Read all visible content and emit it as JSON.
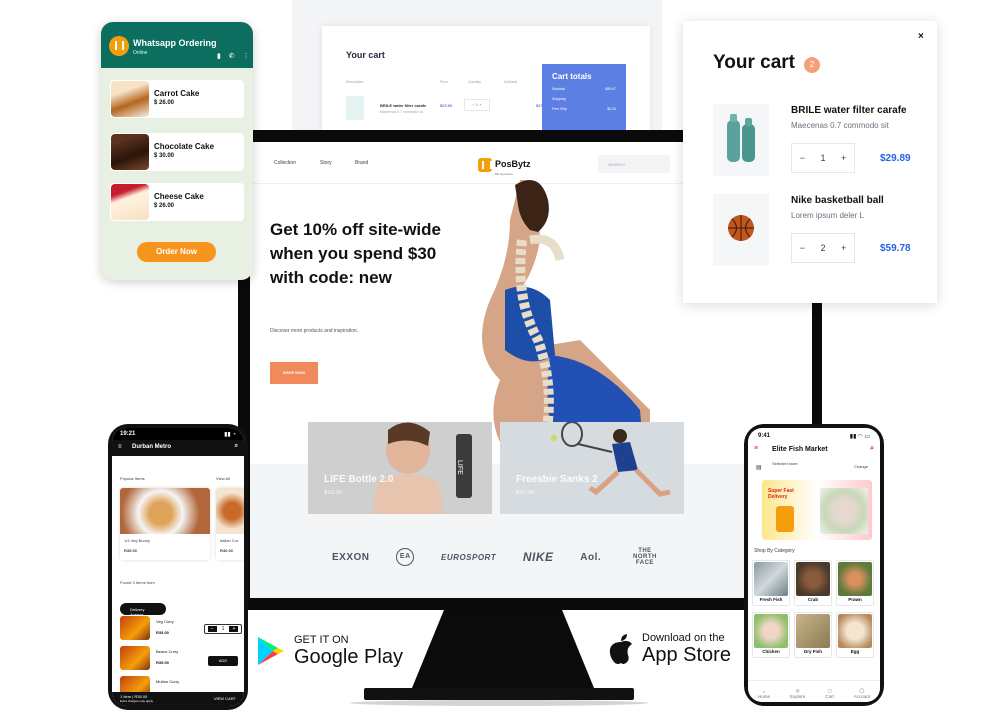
{
  "bg_cart": {
    "title": "Your cart",
    "headers": [
      "Description",
      "Price",
      "Quantity",
      "Subtotal"
    ],
    "item_name": "BRILE water filter carafe",
    "item_sub": "Maecenas 0.7 commodo sit",
    "item_price": "$29.89",
    "item_qty": "1",
    "item_subtotal": "$29.89",
    "totals_title": "Cart totals",
    "totals_rows": [
      [
        "Subtotal",
        "$89.67"
      ],
      [
        "Shipping",
        ""
      ],
      [
        "Free Ship",
        "$0.00"
      ]
    ]
  },
  "site": {
    "nav_links": [
      "Collection",
      "Story",
      "Brand"
    ],
    "logo_name": "PosBytz",
    "logo_tag": "Bill anywhere",
    "search_placeholder": "SEARCH",
    "hero_title": "Get 10% off site-wide when you spend $30 with code: new",
    "hero_subtitle": "Discover more products and inspiration.",
    "hero_button": "SHOP NOW",
    "tiles": [
      {
        "label": "LIFE Bottle 2.0",
        "price": "$10.00"
      },
      {
        "label": "Freesbie Sanks 2",
        "price": "$10.00"
      }
    ],
    "brands": [
      "EXXON",
      "EA",
      "EUROSPORT",
      "NIKE",
      "Aol.",
      "THE NORTH FACE"
    ]
  },
  "cart": {
    "title": "Your cart",
    "count": "2",
    "close": "×",
    "items": [
      {
        "name": "BRILE water filter carafe",
        "sub": "Maecenas 0.7 commodo sit",
        "qty": "1",
        "price": "$29.89"
      },
      {
        "name": "Nike basketball ball",
        "sub": "Lorem ipsum deler L",
        "qty": "2",
        "price": "$59.78"
      }
    ],
    "minus": "−",
    "plus": "+"
  },
  "whatsapp": {
    "title": "Whatsapp Ordering",
    "status": "Online",
    "icons": "▮ ✆ ⋮",
    "items": [
      {
        "name": "Carrot Cake",
        "price": "$ 26.00"
      },
      {
        "name": "Chocolate Cake",
        "price": "$ 30.00"
      },
      {
        "name": "Cheese Cake",
        "price": "$ 26.00"
      }
    ],
    "button": "Order Now"
  },
  "left_phone": {
    "time": "19:21",
    "status_icons": "▮▮ ◔",
    "store": "Durban Metro",
    "popular": "Popular Items",
    "view_all": "View All",
    "card1_name": "1/4 Veg Bunny",
    "card1_price": "R35.00",
    "card2_name": "Italian Cur",
    "card2_price": "R40.00",
    "found": "Found 3 Items from",
    "location": "Delivery Avenue",
    "rows": [
      {
        "name": "Veg Curry",
        "price": "R35.00"
      },
      {
        "name": "Beans Curry",
        "price": "R35.00"
      },
      {
        "name": "Mutton Curry",
        "price": ""
      }
    ],
    "stepper_qty": "1",
    "add": "ADD",
    "bottom_left": "1 Item | R35.00",
    "bottom_left2": "Extra charges may apply",
    "bottom_right": "VIEW CART"
  },
  "right_phone": {
    "time": "9:41",
    "status_icons": "▮▮ ◠ ▭",
    "store": "Elite Fish Market",
    "selected": "Selected store",
    "change": "Change",
    "banner_title": "Super Fast Delivery",
    "shop_by": "Shop By Category",
    "categories": [
      "Fresh Fish",
      "Crab",
      "Prawn",
      "Chicken",
      "Dry Fish",
      "Egg"
    ],
    "nav": [
      "Home",
      "Explore",
      "Cart",
      "Account"
    ]
  },
  "stores": {
    "google_small": "GET IT ON",
    "google_big": "Google Play",
    "apple_small": "Download on the",
    "apple_big": "App Store"
  }
}
